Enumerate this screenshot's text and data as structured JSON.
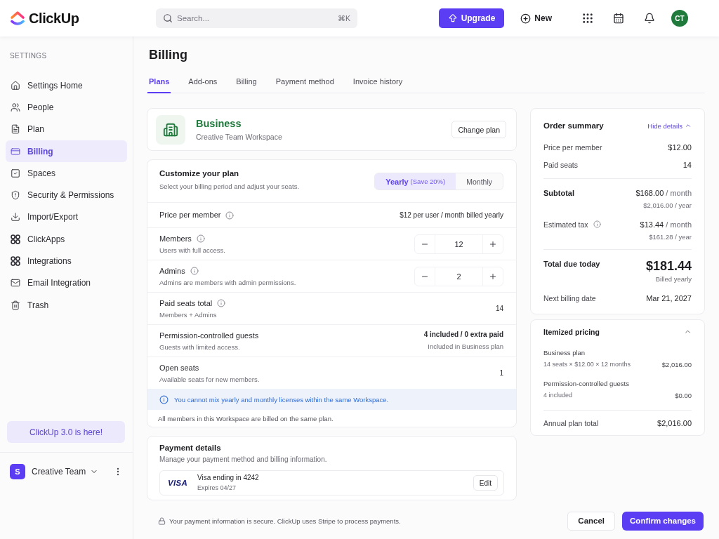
{
  "topbar": {
    "logo": "ClickUp",
    "search": {
      "placeholder": "Search...",
      "shortcut": "⌘K"
    },
    "upgrade": "Upgrade",
    "new": "New",
    "avatar": "CT"
  },
  "sidebar": {
    "heading": "SETTINGS",
    "items": [
      {
        "label": "Settings Home",
        "selected": false
      },
      {
        "label": "People",
        "selected": false
      },
      {
        "label": "Plan",
        "selected": false
      },
      {
        "label": "Billing",
        "selected": true
      },
      {
        "label": "Spaces",
        "selected": false
      },
      {
        "label": "Security & Permissions",
        "selected": false
      },
      {
        "label": "Import/Export",
        "selected": false
      },
      {
        "label": "ClickApps",
        "selected": false
      },
      {
        "label": "Integrations",
        "selected": false
      },
      {
        "label": "Email Integration",
        "selected": false
      },
      {
        "label": "Trash",
        "selected": false
      }
    ],
    "promo": "ClickUp 3.0 is here!",
    "workspace": {
      "initial": "S",
      "name": "Creative Team"
    }
  },
  "page": {
    "title": "Billing",
    "tabs": [
      {
        "label": "Plans",
        "selected": true
      },
      {
        "label": "Add-ons",
        "selected": false
      },
      {
        "label": "Billing",
        "selected": false
      },
      {
        "label": "Payment method",
        "selected": false
      },
      {
        "label": "Invoice history",
        "selected": false
      }
    ]
  },
  "plan": {
    "name": "Business",
    "workspace": "Creative Team Workspace",
    "button": "Change plan"
  },
  "customize": {
    "title": "Customize your plan",
    "subtitle": "Select your billing period and adjust your seats.",
    "periods": [
      {
        "label": "Yearly",
        "badge": "(Save 20%)",
        "selected": true
      },
      {
        "label": "Monthly",
        "selected": false
      }
    ],
    "rows": [
      {
        "kind": "value",
        "label": "Price per member",
        "info": true,
        "value": "$12 per user / month billed yearly"
      },
      {
        "kind": "stepper",
        "label": "Members",
        "info": true,
        "sublabel": "Users with full access.",
        "value": "12"
      },
      {
        "kind": "stepper",
        "label": "Admins",
        "info": true,
        "sublabel": "Admins are members with admin permissions.",
        "value": "2"
      },
      {
        "kind": "value",
        "label": "Paid seats total",
        "info": true,
        "sublabel": "Members + Admins",
        "value": "14"
      },
      {
        "kind": "value",
        "label": "Permission-controlled guests",
        "info": false,
        "sublabel": "Guests with limited access.",
        "value": "4 included / 0 extra paid",
        "note": "Included in Business plan"
      },
      {
        "kind": "value",
        "label": "Open seats",
        "info": false,
        "sublabel": "Available seats for new members.",
        "value": "1"
      }
    ],
    "notice": "You cannot mix yearly and monthly licenses within the same Workspace.",
    "footnote": "All members in this Workspace are billed on the same plan."
  },
  "payment": {
    "title": "Payment details",
    "subtitle": "Manage your payment method and billing information.",
    "card": {
      "brand": "VISA",
      "label": "Visa ending in 4242",
      "expiry": "Expires 04/27",
      "button": "Edit"
    }
  },
  "order_summary": {
    "title": "Order summary",
    "toggle": "Hide details",
    "sections": [
      {
        "lines": [
          {
            "kind": "plain",
            "label": "Price per member",
            "info": false,
            "value": "$12.00"
          },
          {
            "kind": "plain",
            "label": "Paid seats",
            "info": false,
            "value": "14"
          }
        ]
      },
      {
        "lines": [
          {
            "kind": "strong",
            "label": "Subtotal",
            "info": false,
            "value": "$168.00",
            "unit": "/ month",
            "note": "$2,016.00 / year"
          },
          {
            "kind": "plain",
            "label": "Estimated tax",
            "info": true,
            "value": "$13.44",
            "unit": "/ month",
            "note": "$161.28 / year"
          }
        ]
      },
      {
        "lines": [
          {
            "kind": "total",
            "label": "Total due today",
            "info": false,
            "value": "$181.44",
            "note": "Billed yearly"
          },
          {
            "kind": "plain",
            "label": "Next billing date",
            "info": false,
            "value": "Mar 21, 2027"
          }
        ]
      }
    ]
  },
  "itemized": {
    "title": "Itemized pricing",
    "items": [
      {
        "label": "Business plan",
        "detail": "14 seats × $12.00 × 12 months",
        "amount": "$2,016.00"
      },
      {
        "label": "Permission-controlled guests",
        "detail": "4 included",
        "amount": "$0.00"
      }
    ],
    "total": {
      "label": "Annual plan total",
      "value": "$2,016.00"
    }
  },
  "footer": {
    "note": "Your payment information is secure. ClickUp uses Stripe to process payments.",
    "cancel": "Cancel",
    "confirm": "Confirm changes"
  }
}
